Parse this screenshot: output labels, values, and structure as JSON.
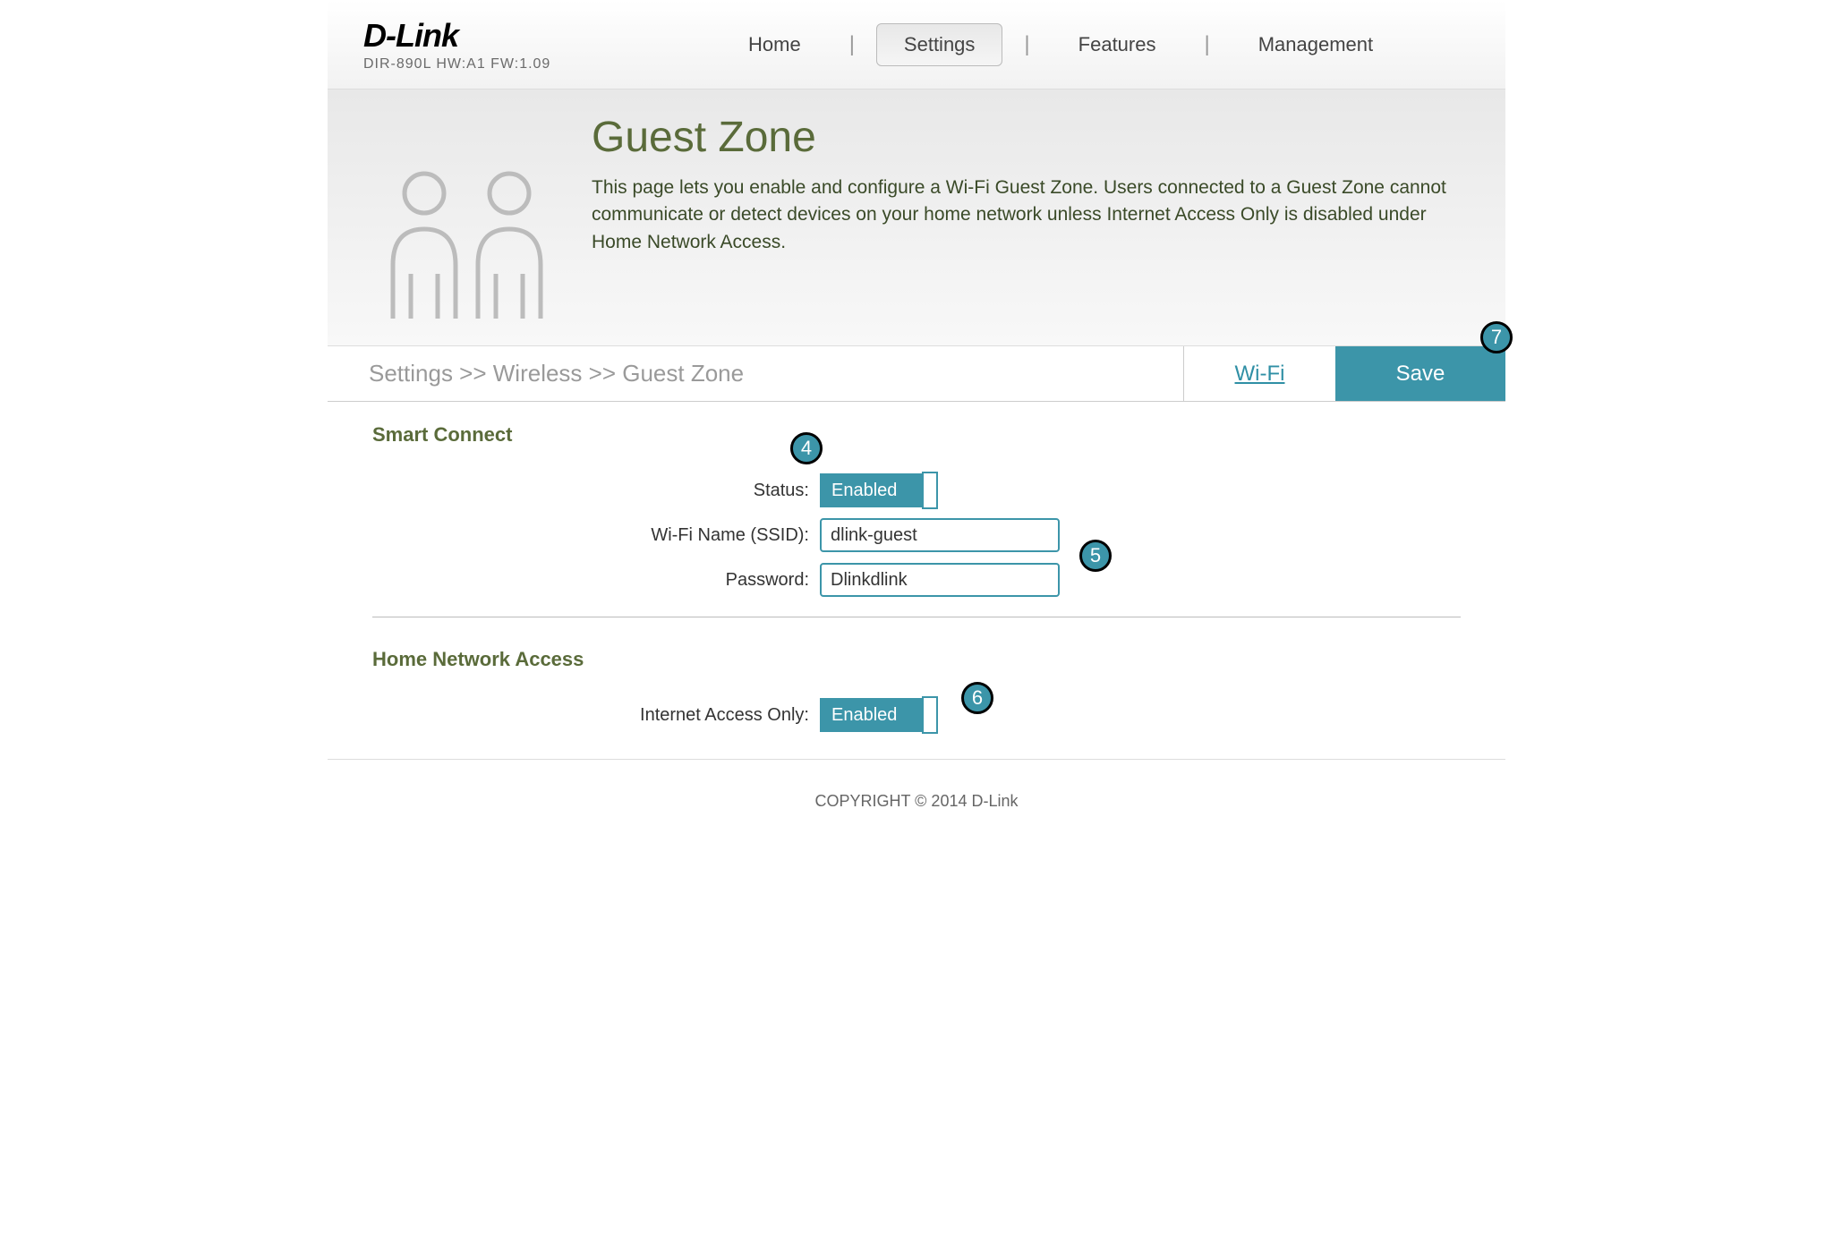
{
  "header": {
    "logo": "D-Link",
    "model": "DIR-890L   HW:A1   FW:1.09",
    "nav": {
      "home": "Home",
      "settings": "Settings",
      "features": "Features",
      "management": "Management"
    }
  },
  "hero": {
    "title": "Guest Zone",
    "desc": "This page lets you enable and configure a Wi-Fi Guest Zone. Users connected to a Guest Zone cannot communicate or detect devices on your home network unless Internet Access Only is disabled under Home Network Access."
  },
  "breadcrumb": "Settings >> Wireless >> Guest Zone",
  "buttons": {
    "wifi": "Wi-Fi",
    "save": "Save"
  },
  "sections": {
    "smart_connect": {
      "title": "Smart Connect",
      "status_label": "Status:",
      "status_value": "Enabled",
      "ssid_label": "Wi-Fi Name (SSID):",
      "ssid_value": "dlink-guest",
      "password_label": "Password:",
      "password_value": "Dlinkdlink"
    },
    "home_access": {
      "title": "Home Network Access",
      "iao_label": "Internet Access Only:",
      "iao_value": "Enabled"
    }
  },
  "callouts": {
    "c4": "4",
    "c5": "5",
    "c6": "6",
    "c7": "7"
  },
  "footer": "COPYRIGHT © 2014 D-Link"
}
